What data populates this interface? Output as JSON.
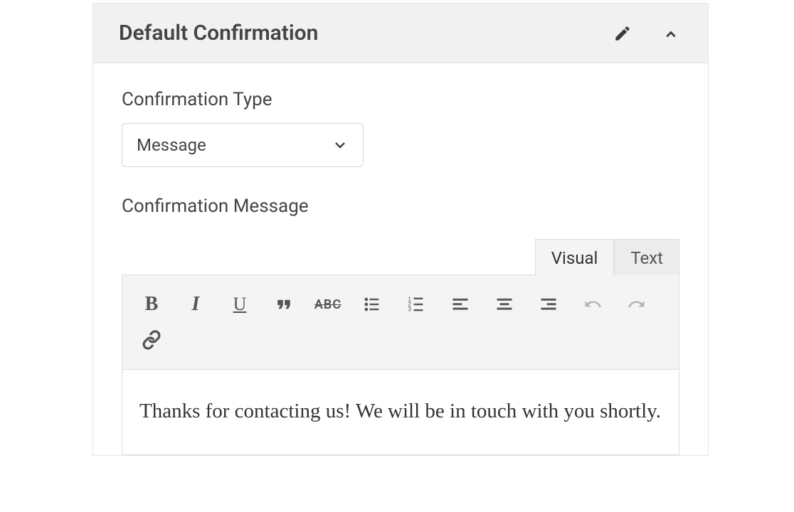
{
  "panel": {
    "title": "Default Confirmation"
  },
  "form": {
    "type_label": "Confirmation Type",
    "type_value": "Message",
    "message_label": "Confirmation Message"
  },
  "editor": {
    "tabs": {
      "visual": "Visual",
      "text": "Text"
    },
    "toolbar": {
      "bold": "B",
      "italic": "I",
      "underline": "U",
      "strikethrough": "ABC"
    },
    "content": "Thanks for contacting us! We will be in touch with you shortly."
  }
}
